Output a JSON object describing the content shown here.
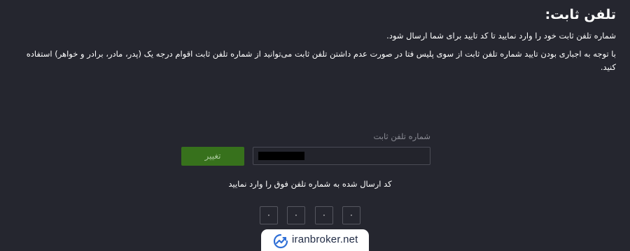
{
  "page": {
    "title": "تلفن ثابت:",
    "description_line1": "شماره تلفن ثابت خود را وارد نمایید تا کد تایید برای شما ارسال شود.",
    "description_line2": "با توجه به اجباری بودن تایید شماره تلفن ثابت از سوی پلیس فتا در صورت عدم داشتن تلفن ثابت می‌توانید از شماره تلفن ثابت اقوام درجه یک (پدر، مادر، برادر و خواهر) استفاده کنید."
  },
  "form": {
    "phone_label": "شماره تلفن ثابت",
    "change_button_label": "تغییر",
    "code_hint": "کد ارسال شده به شماره تلفن فوق را وارد نمایید",
    "code_digits": [
      "۰",
      "۰",
      "۰",
      "۰"
    ]
  },
  "watermark": {
    "text": "iranbroker.net"
  },
  "colors": {
    "background": "#25262f",
    "button_green": "#37711c",
    "label_gray": "#8b8c95",
    "input_border": "#4a4b55"
  }
}
